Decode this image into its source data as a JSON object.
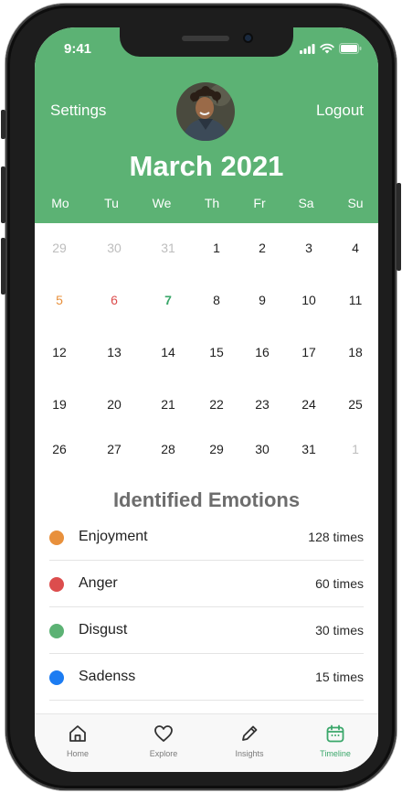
{
  "status_bar": {
    "time": "9:41"
  },
  "header": {
    "settings_label": "Settings",
    "logout_label": "Logout",
    "month_title": "March 2021",
    "weekdays": [
      "Mo",
      "Tu",
      "We",
      "Th",
      "Fr",
      "Sa",
      "Su"
    ]
  },
  "calendar": {
    "weeks": [
      [
        "29",
        "30",
        "31",
        "1",
        "2",
        "3",
        "4"
      ],
      [
        "5",
        "6",
        "7",
        "8",
        "9",
        "10",
        "11"
      ],
      [
        "12",
        "13",
        "14",
        "15",
        "16",
        "17",
        "18"
      ],
      [
        "19",
        "20",
        "21",
        "22",
        "23",
        "24",
        "25"
      ],
      [
        "26",
        "27",
        "28",
        "29",
        "30",
        "31",
        "1"
      ]
    ]
  },
  "emotions": {
    "title": "Identified Emotions",
    "items": [
      {
        "name": "Enjoyment",
        "count": "128 times",
        "color": "#e8903c"
      },
      {
        "name": "Anger",
        "count": "60 times",
        "color": "#dc4d4d"
      },
      {
        "name": "Disgust",
        "count": "30 times",
        "color": "#5cb274"
      },
      {
        "name": "Sadenss",
        "count": "15 times",
        "color": "#1c7cf2"
      }
    ]
  },
  "colors": {
    "header_green": "#5cb274",
    "enjoyment": "#e8903c",
    "anger": "#dc4d4d",
    "disgust": "#5cb274",
    "sadness": "#1c7cf2",
    "active_tab": "#3aa76a"
  },
  "bottom_nav": {
    "items": [
      {
        "label": "Home",
        "icon": "home-icon"
      },
      {
        "label": "Explore",
        "icon": "heart-icon"
      },
      {
        "label": "Insights",
        "icon": "pencil-icon"
      },
      {
        "label": "Timeline",
        "icon": "calendar-icon"
      }
    ],
    "active": "Timeline"
  }
}
